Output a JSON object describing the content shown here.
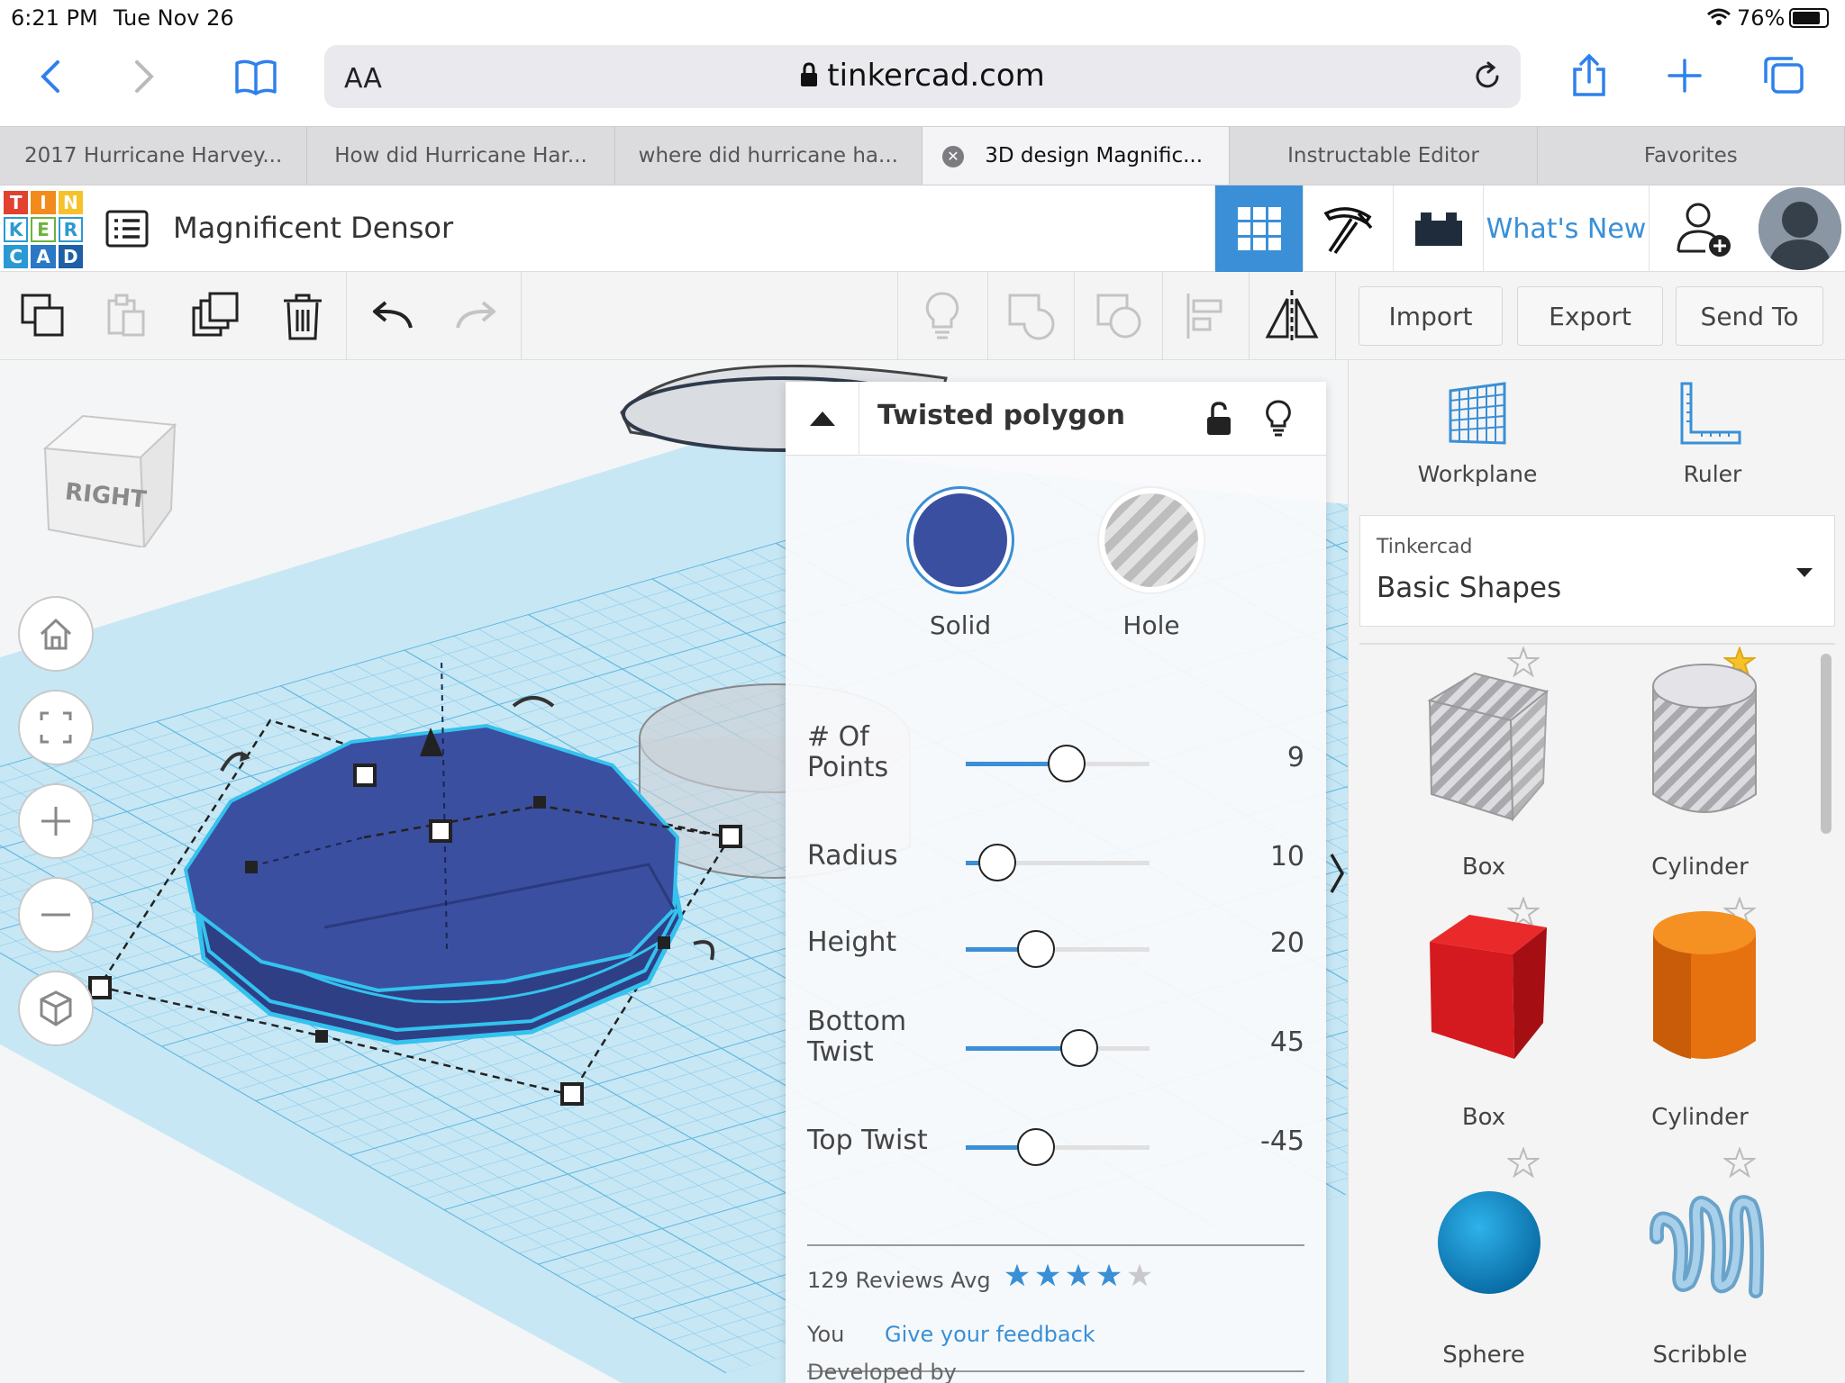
{
  "status_bar": {
    "time": "6:21 PM",
    "date": "Tue Nov 26",
    "battery": "76%"
  },
  "browser": {
    "text_size_label": "AA",
    "domain": "tinkercad.com"
  },
  "tabs": [
    {
      "label": "2017 Hurricane Harvey..."
    },
    {
      "label": "How did Hurricane Har..."
    },
    {
      "label": "where did hurricane ha..."
    },
    {
      "label": "3D design Magnific...",
      "active": true
    },
    {
      "label": "Instructable Editor"
    },
    {
      "label": "Favorites"
    }
  ],
  "tinkercad": {
    "logo_letters": [
      "T",
      "I",
      "N",
      "K",
      "E",
      "R",
      "C",
      "A",
      "D"
    ],
    "design_name": "Magnificent Densor",
    "whats_new": "What's New"
  },
  "toolbar": {
    "import": "Import",
    "export": "Export",
    "send_to": "Send To"
  },
  "view_cube": {
    "label": "RIGHT"
  },
  "inspector": {
    "title": "Twisted polygon",
    "solid_label": "Solid",
    "hole_label": "Hole",
    "solid_color": "#3a4fa0",
    "params": [
      {
        "label": "# Of\nPoints",
        "value": "9",
        "fraction": 0.55
      },
      {
        "label": "Radius",
        "value": "10",
        "fraction": 0.17
      },
      {
        "label": "Height",
        "value": "20",
        "fraction": 0.38
      },
      {
        "label": "Bottom\nTwist",
        "value": "45",
        "fraction": 0.62
      },
      {
        "label": "Top Twist",
        "value": "-45",
        "fraction": 0.38
      }
    ],
    "reviews_text": "129 Reviews Avg",
    "rating": 4,
    "you_label": "You",
    "feedback_link": "Give your feedback",
    "developed_by": "Developed by"
  },
  "right_panel": {
    "workplane": "Workplane",
    "ruler": "Ruler",
    "library_owner": "Tinkercad",
    "library_name": "Basic Shapes",
    "shapes": [
      {
        "label": "Box",
        "favorite": false
      },
      {
        "label": "Cylinder",
        "favorite": true
      },
      {
        "label": "Box",
        "favorite": false
      },
      {
        "label": "Cylinder",
        "favorite": false
      },
      {
        "label": "Sphere",
        "favorite": false
      },
      {
        "label": "Scribble",
        "favorite": false
      }
    ]
  },
  "colors": {
    "accent": "#3a8fd6",
    "shape_blue": "#3a4fa0",
    "grid": "#8fcde8"
  }
}
